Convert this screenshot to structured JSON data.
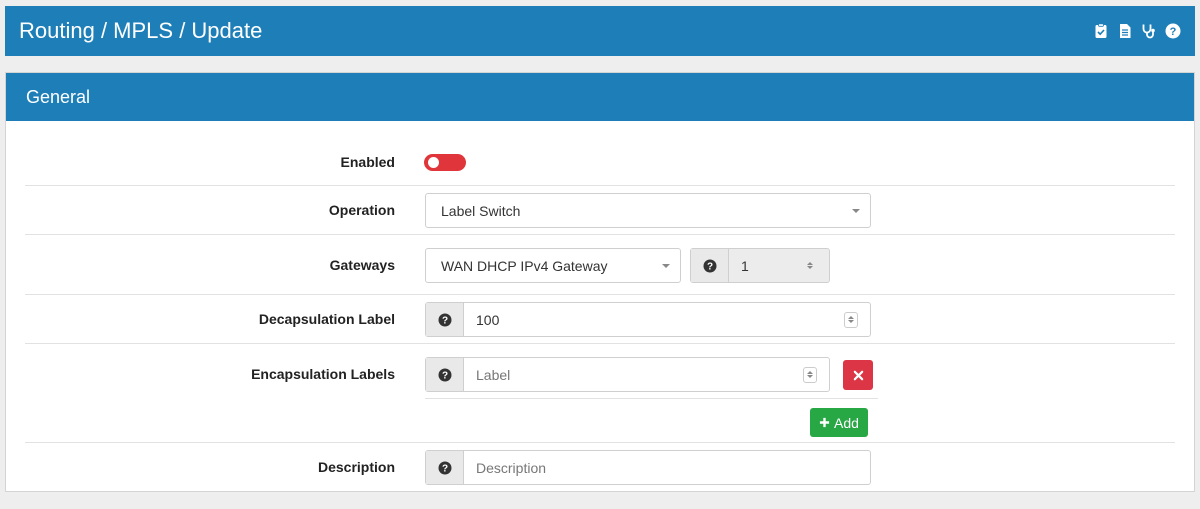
{
  "header": {
    "title": "Routing / MPLS / Update",
    "icons": [
      "clipboard-check-icon",
      "file-icon",
      "stethoscope-icon",
      "help-icon"
    ]
  },
  "panel": {
    "title": "General"
  },
  "form": {
    "enabled": {
      "label": "Enabled",
      "value": false
    },
    "operation": {
      "label": "Operation",
      "value": "Label Switch"
    },
    "gateways": {
      "label": "Gateways",
      "gateway_value": "WAN DHCP IPv4 Gateway",
      "weight_value": "1"
    },
    "decapsulation": {
      "label": "Decapsulation Label",
      "value": "100"
    },
    "encapsulation": {
      "label": "Encapsulation Labels",
      "placeholder": "Label",
      "add_label": "Add"
    },
    "description": {
      "label": "Description",
      "placeholder": "Description"
    }
  },
  "colors": {
    "header": "#1e7fb8",
    "toggle_off": "#e0353b",
    "delete": "#dc3545",
    "add": "#28a745"
  }
}
